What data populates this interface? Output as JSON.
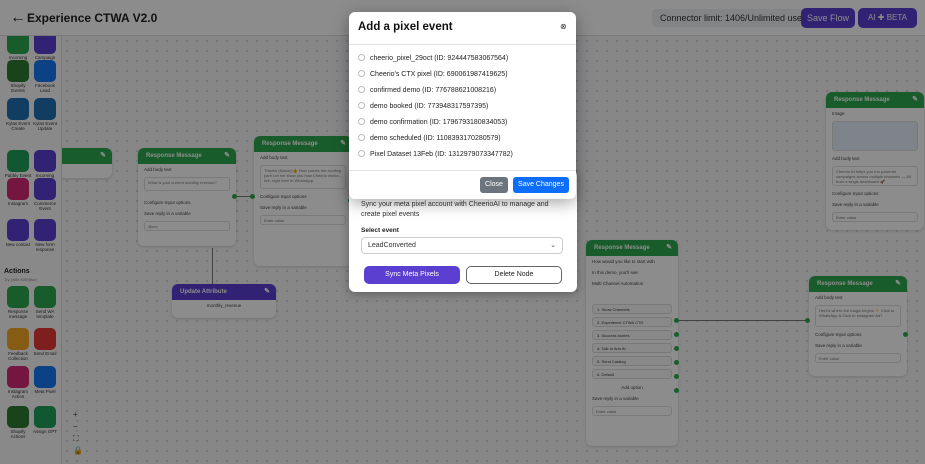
{
  "header": {
    "title": "Experience CTWA V2.0",
    "connector_limit": "Connector limit: 1406/Unlimited used",
    "save_flow_label": "Save Flow",
    "ai_label": "AI ✚ BETA"
  },
  "sidebar": {
    "triggers": [
      {
        "label": "Incoming WhatsApp",
        "icon": "whatsapp-icon",
        "color": "#2fa84f"
      },
      {
        "label": "Campaign Sent",
        "icon": "campaign-icon",
        "color": "#5b3fd1"
      },
      {
        "label": "Shopify Events",
        "icon": "shopify-icon",
        "color": "#2f7d32"
      },
      {
        "label": "Facebook Lead",
        "icon": "facebook-icon",
        "color": "#1877f2"
      },
      {
        "label": "Kylas Event Create",
        "icon": "kylas-icon",
        "color": "#1f6fb2"
      },
      {
        "label": "Kylas Event Update",
        "icon": "kylas-icon",
        "color": "#1f6fb2"
      },
      {
        "label": "Pabbly Event",
        "icon": "pabbly-icon",
        "color": "#1f9f5b"
      },
      {
        "label": "Incoming Webhook",
        "icon": "webhook-icon",
        "color": "#5b3fd1"
      },
      {
        "label": "Instagram",
        "icon": "instagram-icon",
        "color": "#d62976"
      },
      {
        "label": "Commerce Event",
        "icon": "commerce-icon",
        "color": "#5b3fd1"
      },
      {
        "label": "New contact",
        "icon": "contact-icon",
        "color": "#5b3fd1"
      },
      {
        "label": "New form response",
        "icon": "form-icon",
        "color": "#5b3fd1"
      }
    ],
    "actions_heading": "Actions",
    "actions_sub": "Try (with AI/Editor)",
    "actions": [
      {
        "label": "Response message",
        "icon": "message-icon",
        "color": "#2fa84f"
      },
      {
        "label": "Send WA template",
        "icon": "whatsapp-icon",
        "color": "#2fa84f"
      },
      {
        "label": "Feedback Collection",
        "icon": "feedback-icon",
        "color": "#f5a623"
      },
      {
        "label": "Send Email",
        "icon": "email-icon",
        "color": "#e53935"
      },
      {
        "label": "Instagram Action",
        "icon": "instagram-icon",
        "color": "#d62976"
      },
      {
        "label": "Meta Pixel",
        "icon": "meta-icon",
        "color": "#1877f2"
      },
      {
        "label": "Shopify Actions",
        "icon": "shopify-icon",
        "color": "#2f7d32"
      },
      {
        "label": "Assign GPT",
        "icon": "gpt-icon",
        "color": "#1f9f5b"
      }
    ]
  },
  "canvas": {
    "nodes": {
      "response_1": {
        "title": "Response Message",
        "body_label": "Add body text",
        "body": "What is your current monthly revenue?",
        "input_opts": "Configure Input options",
        "save_reply": "Save reply in a variable",
        "var": "@rev"
      },
      "response_2": {
        "title": "Response Message",
        "body_label": "Add body text",
        "body": "Thanks {Name}!👍 How comes the exciting part! Let me show you how Cheerio works - live, right here in WhatsApp.",
        "input_opts": "Configure Input options",
        "save_reply": "Save reply in a variable",
        "var": "Enter value"
      },
      "response_3": {
        "title": "Response Message",
        "image_label": "Image",
        "body_label": "Add body text",
        "body": "Cheerio AI helps you run powerful campaigns across multiple channels — All from a single dashboard 🚀",
        "input_opts": "Configure Input options",
        "save_reply": "Save reply in a variable",
        "var": "Enter value"
      },
      "response_4": {
        "title": "Response Message",
        "body_label": "Add body text",
        "body": "Here's where the magic begins ✨ Click to WhatsApp & Click to Instagram Ad?",
        "input_opts": "Configure Input options",
        "save_reply": "Save reply in a variable",
        "var": "Enter value"
      },
      "response_5": {
        "title": "Response Message",
        "body": "How would you like to start with",
        "body2": "In this demo, you'll see:",
        "body3": "Multi Channel Automation",
        "options": [
          "1. Show Channels",
          "2. Experience CTWA CTD",
          "3. Success stories",
          "4. Talk to Arin AI",
          "5. Send Catalog",
          "6. Default"
        ],
        "add_option": "Add option",
        "save_reply": "Save reply in a variable",
        "var": "Enter value"
      },
      "update_attr": {
        "title": "Update Attribute",
        "value": "monthly_revenue"
      }
    }
  },
  "meta_pixel_dialog": {
    "description": "Sync your meta pixel account with CheerioAI to manage and create pixel events",
    "select_label": "Select event",
    "selected_event": "LeadConverted",
    "sync_label": "Sync Meta Pixels",
    "delete_label": "Delete Node"
  },
  "modal": {
    "title": "Add a pixel event",
    "events": [
      "cheerio_pixel_29oct (ID: 924447583067564)",
      "Cheerio's CTX pixel (ID: 690061987419625)",
      "confirmed demo (ID: 776788621008216)",
      "demo booked (ID: 773948317597395)",
      "demo confirmation (ID: 1796793180834053)",
      "demo scheduled (ID: 1108393170280579)",
      "Pixel Dataset 13Feb (ID: 1312979073347782)"
    ],
    "close_label": "Close",
    "save_label": "Save Changes"
  }
}
